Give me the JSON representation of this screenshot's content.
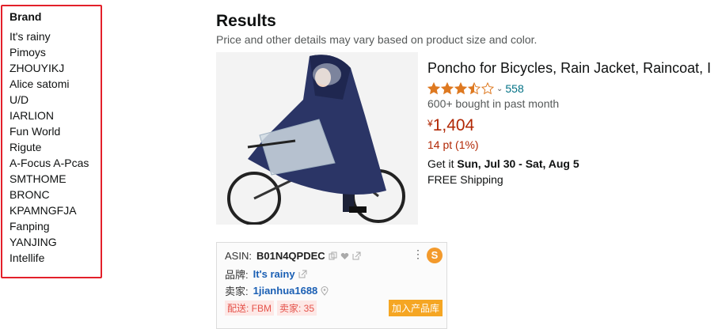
{
  "brand_filter": {
    "title": "Brand",
    "items": [
      "It's rainy",
      "Pimoys",
      "ZHOUYIKJ",
      "Alice satomi",
      "U/D",
      "IARLION",
      "Fun World",
      "Rigute",
      "A-Focus A-Pcas",
      "SMTHOME",
      "BRONC",
      "KPAMNGFJA",
      "Fanping",
      "YANJING",
      "Intellife"
    ]
  },
  "results": {
    "title": "Results",
    "subtitle": "Price and other details may vary based on product size and color."
  },
  "product": {
    "title": "Poncho for Bicycles, Rain Jacket, Raincoat, I",
    "rating": 3.5,
    "rating_count": "558",
    "bought": "600+ bought in past month",
    "price_symbol": "¥",
    "price": "1,404",
    "points": "14 pt (1%)",
    "delivery_prefix": "Get it",
    "delivery_dates": "Sun, Jul 30 - Sat, Aug 5",
    "shipping": "FREE Shipping"
  },
  "seller_box": {
    "asin_label": "ASIN:",
    "asin": "B01N4QPDEC",
    "brand_label": "品牌:",
    "brand": "It's rainy",
    "seller_label": "卖家:",
    "seller": "1jianhua1688",
    "tag_fbm": "配送: FBM",
    "tag_sellers": "卖家: 35",
    "add_button": "加入产品库",
    "logo_letter": "S"
  },
  "colors": {
    "highlight_border": "#e3202a",
    "link": "#007185",
    "price": "#b12704",
    "star": "#de7921",
    "add_button": "#f5a623"
  }
}
